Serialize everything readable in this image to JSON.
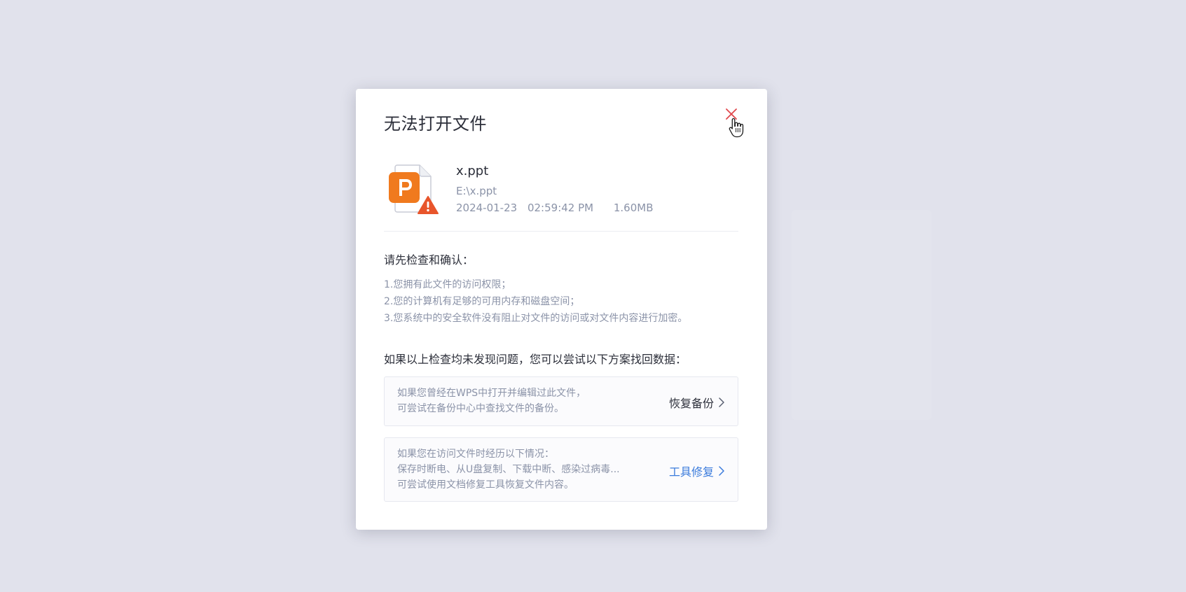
{
  "dialog": {
    "title": "无法打开文件",
    "file": {
      "name": "x.ppt",
      "path": "E:\\x.ppt",
      "date": "2024-01-23",
      "time": "02:59:42 PM",
      "size": "1.60MB",
      "icon": "ppt-file-warning-icon"
    },
    "check_heading": "请先检查和确认：",
    "check_items": [
      "1.您拥有此文件的访问权限；",
      "2.您的计算机有足够的可用内存和磁盘空间；",
      "3.您系统中的安全软件没有阻止对文件的访问或对文件内容进行加密。"
    ],
    "recover_heading": "如果以上检查均未发现问题，您可以尝试以下方案找回数据：",
    "options": [
      {
        "lines": [
          "如果您曾经在WPS中打开并编辑过此文件，",
          "可尝试在备份中心中查找文件的备份。"
        ],
        "action": "恢复备份"
      },
      {
        "lines": [
          "如果您在访问文件时经历以下情况：",
          "保存时断电、从U盘复制、下载中断、感染过病毒...",
          "可尝试使用文档修复工具恢复文件内容。"
        ],
        "action": "工具修复"
      }
    ]
  },
  "colors": {
    "background": "#e1e2ec",
    "close_icon": "#e0474c",
    "link_blue": "#3b7bdc",
    "ppt_orange": "#f07a1e",
    "warning_red": "#e8552b"
  }
}
